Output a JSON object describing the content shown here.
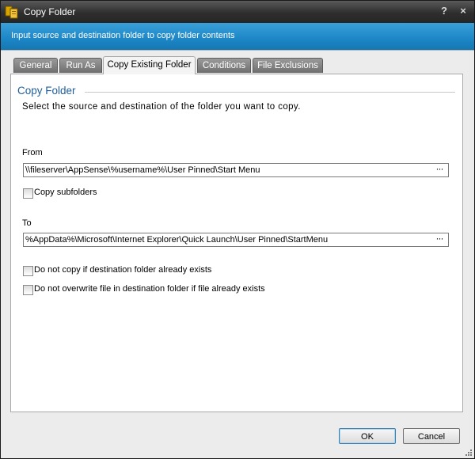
{
  "window": {
    "title": "Copy Folder",
    "help_glyph": "?",
    "close_glyph": "×"
  },
  "banner": {
    "text": "Input source and destination folder to copy folder contents"
  },
  "tabs": [
    {
      "label": "General",
      "active": false
    },
    {
      "label": "Run As",
      "active": false
    },
    {
      "label": "Copy Existing Folder",
      "active": true
    },
    {
      "label": "Conditions",
      "active": false
    },
    {
      "label": "File Exclusions",
      "active": false
    }
  ],
  "panel": {
    "section_title": "Copy Folder",
    "description": "Select the source and destination of the folder you want to copy.",
    "from": {
      "label": "From",
      "value": "\\\\fileserver\\AppSense\\%username%\\User Pinned\\Start Menu",
      "browse_label": "···"
    },
    "copy_subfolders": {
      "label": "Copy subfolders",
      "checked": false
    },
    "to": {
      "label": "To",
      "value": "%AppData%\\Microsoft\\Internet Explorer\\Quick Launch\\User Pinned\\StartMenu",
      "browse_label": "···"
    },
    "no_copy_if_exists": {
      "label": "Do not copy if destination folder already exists",
      "checked": false
    },
    "no_overwrite": {
      "label": "Do not overwrite file in destination folder if file already exists",
      "checked": false
    }
  },
  "buttons": {
    "ok": "OK",
    "cancel": "Cancel"
  },
  "colors": {
    "titlebar": "#2e2e2e",
    "banner": "#1c86c6",
    "section_title": "#1f5e9a"
  },
  "icons": {
    "app": "folder-copy-icon",
    "help": "help-icon",
    "close": "close-icon",
    "grip": "resize-grip-icon"
  }
}
